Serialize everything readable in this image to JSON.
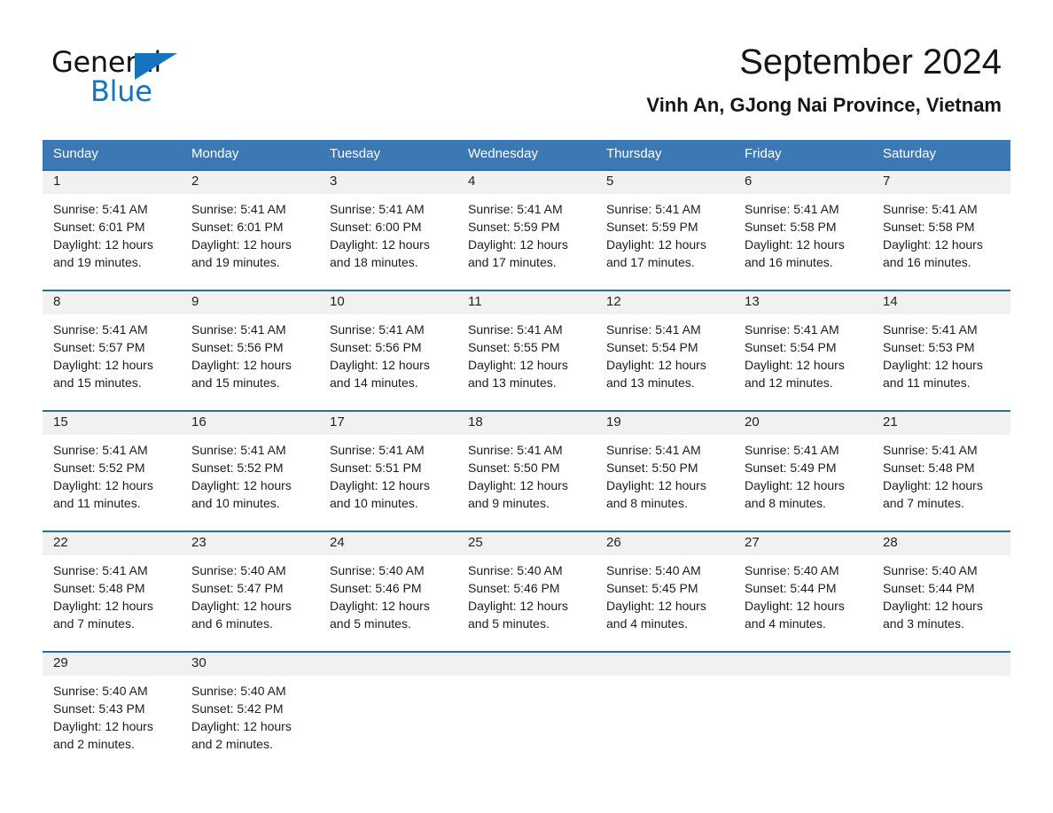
{
  "brand": {
    "word1": "General",
    "word2": "Blue",
    "triangle_color": "#1574bd"
  },
  "header": {
    "title": "September 2024",
    "subtitle": "Vinh An, GJong Nai Province, Vietnam"
  },
  "theme": {
    "header_blue": "#3b78b4",
    "rule_blue": "#2e6da4",
    "daynum_band": "#f1f1f1",
    "text": "#1c1c1c"
  },
  "weekdays": [
    "Sunday",
    "Monday",
    "Tuesday",
    "Wednesday",
    "Thursday",
    "Friday",
    "Saturday"
  ],
  "weeks": [
    [
      {
        "day": "1",
        "sunrise": "Sunrise: 5:41 AM",
        "sunset": "Sunset: 6:01 PM",
        "daylight1": "Daylight: 12 hours",
        "daylight2": "and 19 minutes."
      },
      {
        "day": "2",
        "sunrise": "Sunrise: 5:41 AM",
        "sunset": "Sunset: 6:01 PM",
        "daylight1": "Daylight: 12 hours",
        "daylight2": "and 19 minutes."
      },
      {
        "day": "3",
        "sunrise": "Sunrise: 5:41 AM",
        "sunset": "Sunset: 6:00 PM",
        "daylight1": "Daylight: 12 hours",
        "daylight2": "and 18 minutes."
      },
      {
        "day": "4",
        "sunrise": "Sunrise: 5:41 AM",
        "sunset": "Sunset: 5:59 PM",
        "daylight1": "Daylight: 12 hours",
        "daylight2": "and 17 minutes."
      },
      {
        "day": "5",
        "sunrise": "Sunrise: 5:41 AM",
        "sunset": "Sunset: 5:59 PM",
        "daylight1": "Daylight: 12 hours",
        "daylight2": "and 17 minutes."
      },
      {
        "day": "6",
        "sunrise": "Sunrise: 5:41 AM",
        "sunset": "Sunset: 5:58 PM",
        "daylight1": "Daylight: 12 hours",
        "daylight2": "and 16 minutes."
      },
      {
        "day": "7",
        "sunrise": "Sunrise: 5:41 AM",
        "sunset": "Sunset: 5:58 PM",
        "daylight1": "Daylight: 12 hours",
        "daylight2": "and 16 minutes."
      }
    ],
    [
      {
        "day": "8",
        "sunrise": "Sunrise: 5:41 AM",
        "sunset": "Sunset: 5:57 PM",
        "daylight1": "Daylight: 12 hours",
        "daylight2": "and 15 minutes."
      },
      {
        "day": "9",
        "sunrise": "Sunrise: 5:41 AM",
        "sunset": "Sunset: 5:56 PM",
        "daylight1": "Daylight: 12 hours",
        "daylight2": "and 15 minutes."
      },
      {
        "day": "10",
        "sunrise": "Sunrise: 5:41 AM",
        "sunset": "Sunset: 5:56 PM",
        "daylight1": "Daylight: 12 hours",
        "daylight2": "and 14 minutes."
      },
      {
        "day": "11",
        "sunrise": "Sunrise: 5:41 AM",
        "sunset": "Sunset: 5:55 PM",
        "daylight1": "Daylight: 12 hours",
        "daylight2": "and 13 minutes."
      },
      {
        "day": "12",
        "sunrise": "Sunrise: 5:41 AM",
        "sunset": "Sunset: 5:54 PM",
        "daylight1": "Daylight: 12 hours",
        "daylight2": "and 13 minutes."
      },
      {
        "day": "13",
        "sunrise": "Sunrise: 5:41 AM",
        "sunset": "Sunset: 5:54 PM",
        "daylight1": "Daylight: 12 hours",
        "daylight2": "and 12 minutes."
      },
      {
        "day": "14",
        "sunrise": "Sunrise: 5:41 AM",
        "sunset": "Sunset: 5:53 PM",
        "daylight1": "Daylight: 12 hours",
        "daylight2": "and 11 minutes."
      }
    ],
    [
      {
        "day": "15",
        "sunrise": "Sunrise: 5:41 AM",
        "sunset": "Sunset: 5:52 PM",
        "daylight1": "Daylight: 12 hours",
        "daylight2": "and 11 minutes."
      },
      {
        "day": "16",
        "sunrise": "Sunrise: 5:41 AM",
        "sunset": "Sunset: 5:52 PM",
        "daylight1": "Daylight: 12 hours",
        "daylight2": "and 10 minutes."
      },
      {
        "day": "17",
        "sunrise": "Sunrise: 5:41 AM",
        "sunset": "Sunset: 5:51 PM",
        "daylight1": "Daylight: 12 hours",
        "daylight2": "and 10 minutes."
      },
      {
        "day": "18",
        "sunrise": "Sunrise: 5:41 AM",
        "sunset": "Sunset: 5:50 PM",
        "daylight1": "Daylight: 12 hours",
        "daylight2": "and 9 minutes."
      },
      {
        "day": "19",
        "sunrise": "Sunrise: 5:41 AM",
        "sunset": "Sunset: 5:50 PM",
        "daylight1": "Daylight: 12 hours",
        "daylight2": "and 8 minutes."
      },
      {
        "day": "20",
        "sunrise": "Sunrise: 5:41 AM",
        "sunset": "Sunset: 5:49 PM",
        "daylight1": "Daylight: 12 hours",
        "daylight2": "and 8 minutes."
      },
      {
        "day": "21",
        "sunrise": "Sunrise: 5:41 AM",
        "sunset": "Sunset: 5:48 PM",
        "daylight1": "Daylight: 12 hours",
        "daylight2": "and 7 minutes."
      }
    ],
    [
      {
        "day": "22",
        "sunrise": "Sunrise: 5:41 AM",
        "sunset": "Sunset: 5:48 PM",
        "daylight1": "Daylight: 12 hours",
        "daylight2": "and 7 minutes."
      },
      {
        "day": "23",
        "sunrise": "Sunrise: 5:40 AM",
        "sunset": "Sunset: 5:47 PM",
        "daylight1": "Daylight: 12 hours",
        "daylight2": "and 6 minutes."
      },
      {
        "day": "24",
        "sunrise": "Sunrise: 5:40 AM",
        "sunset": "Sunset: 5:46 PM",
        "daylight1": "Daylight: 12 hours",
        "daylight2": "and 5 minutes."
      },
      {
        "day": "25",
        "sunrise": "Sunrise: 5:40 AM",
        "sunset": "Sunset: 5:46 PM",
        "daylight1": "Daylight: 12 hours",
        "daylight2": "and 5 minutes."
      },
      {
        "day": "26",
        "sunrise": "Sunrise: 5:40 AM",
        "sunset": "Sunset: 5:45 PM",
        "daylight1": "Daylight: 12 hours",
        "daylight2": "and 4 minutes."
      },
      {
        "day": "27",
        "sunrise": "Sunrise: 5:40 AM",
        "sunset": "Sunset: 5:44 PM",
        "daylight1": "Daylight: 12 hours",
        "daylight2": "and 4 minutes."
      },
      {
        "day": "28",
        "sunrise": "Sunrise: 5:40 AM",
        "sunset": "Sunset: 5:44 PM",
        "daylight1": "Daylight: 12 hours",
        "daylight2": "and 3 minutes."
      }
    ],
    [
      {
        "day": "29",
        "sunrise": "Sunrise: 5:40 AM",
        "sunset": "Sunset: 5:43 PM",
        "daylight1": "Daylight: 12 hours",
        "daylight2": "and 2 minutes."
      },
      {
        "day": "30",
        "sunrise": "Sunrise: 5:40 AM",
        "sunset": "Sunset: 5:42 PM",
        "daylight1": "Daylight: 12 hours",
        "daylight2": "and 2 minutes."
      },
      {
        "day": "",
        "sunrise": "",
        "sunset": "",
        "daylight1": "",
        "daylight2": ""
      },
      {
        "day": "",
        "sunrise": "",
        "sunset": "",
        "daylight1": "",
        "daylight2": ""
      },
      {
        "day": "",
        "sunrise": "",
        "sunset": "",
        "daylight1": "",
        "daylight2": ""
      },
      {
        "day": "",
        "sunrise": "",
        "sunset": "",
        "daylight1": "",
        "daylight2": ""
      },
      {
        "day": "",
        "sunrise": "",
        "sunset": "",
        "daylight1": "",
        "daylight2": ""
      }
    ]
  ]
}
